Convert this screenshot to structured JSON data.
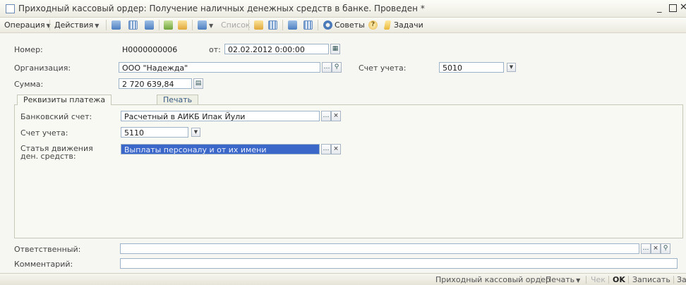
{
  "window": {
    "title": "Приходный кассовый ордер: Получение наличных денежных средств в банке. Проведен *"
  },
  "toolbar": {
    "operations_label": "Операция",
    "actions_label": "Действия",
    "based_on_label": "Список",
    "tips_label": "Советы",
    "tasks_label": "Задачи"
  },
  "form": {
    "number_label": "Номер:",
    "number_value": "Н0000000006",
    "date_label": "от:",
    "date_value": "02.02.2012  0:00:00",
    "org_label": "Организация:",
    "org_value": "ООО \"Надежда\"",
    "account_label": "Счет учета:",
    "account_value": "5010",
    "sum_label": "Сумма:",
    "sum_value": "2 720 639,84"
  },
  "tabs": [
    {
      "label": "Реквизиты платежа",
      "active": true
    },
    {
      "label": "Печать",
      "active": false
    }
  ],
  "payment": {
    "bank_account_label": "Банковский счет:",
    "bank_account_value": "Расчетный в АИКБ Ипак Йули",
    "account_label": "Счет учета:",
    "account_value": "5110",
    "cashflow_label_line1": "Статья движения",
    "cashflow_label_line2": "ден. средств:",
    "cashflow_value": "Выплаты персоналу и от их имени"
  },
  "footer_fields": {
    "responsible_label": "Ответственный:",
    "responsible_value": "",
    "comment_label": "Комментарий:",
    "comment_value": ""
  },
  "statusbar": {
    "doc_print_label": "Приходный кассовый ордер",
    "print_label": "Печать",
    "check_label": "Чек",
    "ok_label": "OK",
    "save_label": "Записать",
    "close_label": "Закрыть"
  }
}
